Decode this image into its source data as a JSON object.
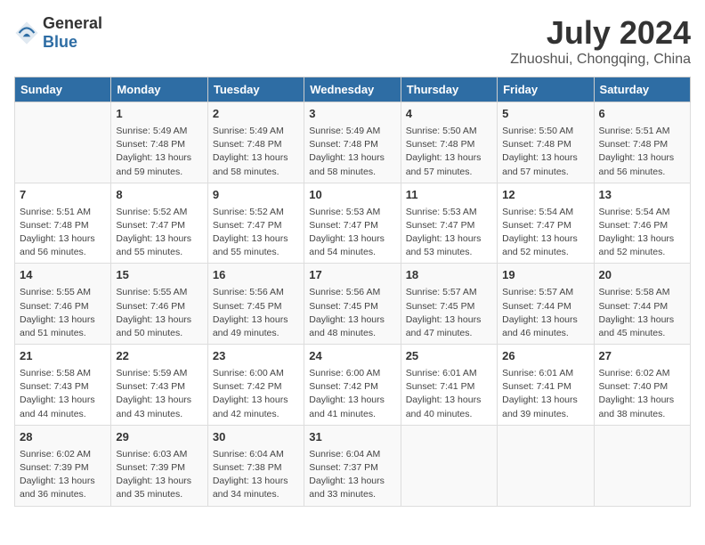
{
  "header": {
    "logo_general": "General",
    "logo_blue": "Blue",
    "title": "July 2024",
    "subtitle": "Zhuoshui, Chongqing, China"
  },
  "columns": [
    "Sunday",
    "Monday",
    "Tuesday",
    "Wednesday",
    "Thursday",
    "Friday",
    "Saturday"
  ],
  "weeks": [
    [
      {
        "day": "",
        "content": ""
      },
      {
        "day": "1",
        "content": "Sunrise: 5:49 AM\nSunset: 7:48 PM\nDaylight: 13 hours\nand 59 minutes."
      },
      {
        "day": "2",
        "content": "Sunrise: 5:49 AM\nSunset: 7:48 PM\nDaylight: 13 hours\nand 58 minutes."
      },
      {
        "day": "3",
        "content": "Sunrise: 5:49 AM\nSunset: 7:48 PM\nDaylight: 13 hours\nand 58 minutes."
      },
      {
        "day": "4",
        "content": "Sunrise: 5:50 AM\nSunset: 7:48 PM\nDaylight: 13 hours\nand 57 minutes."
      },
      {
        "day": "5",
        "content": "Sunrise: 5:50 AM\nSunset: 7:48 PM\nDaylight: 13 hours\nand 57 minutes."
      },
      {
        "day": "6",
        "content": "Sunrise: 5:51 AM\nSunset: 7:48 PM\nDaylight: 13 hours\nand 56 minutes."
      }
    ],
    [
      {
        "day": "7",
        "content": "Sunrise: 5:51 AM\nSunset: 7:48 PM\nDaylight: 13 hours\nand 56 minutes."
      },
      {
        "day": "8",
        "content": "Sunrise: 5:52 AM\nSunset: 7:47 PM\nDaylight: 13 hours\nand 55 minutes."
      },
      {
        "day": "9",
        "content": "Sunrise: 5:52 AM\nSunset: 7:47 PM\nDaylight: 13 hours\nand 55 minutes."
      },
      {
        "day": "10",
        "content": "Sunrise: 5:53 AM\nSunset: 7:47 PM\nDaylight: 13 hours\nand 54 minutes."
      },
      {
        "day": "11",
        "content": "Sunrise: 5:53 AM\nSunset: 7:47 PM\nDaylight: 13 hours\nand 53 minutes."
      },
      {
        "day": "12",
        "content": "Sunrise: 5:54 AM\nSunset: 7:47 PM\nDaylight: 13 hours\nand 52 minutes."
      },
      {
        "day": "13",
        "content": "Sunrise: 5:54 AM\nSunset: 7:46 PM\nDaylight: 13 hours\nand 52 minutes."
      }
    ],
    [
      {
        "day": "14",
        "content": "Sunrise: 5:55 AM\nSunset: 7:46 PM\nDaylight: 13 hours\nand 51 minutes."
      },
      {
        "day": "15",
        "content": "Sunrise: 5:55 AM\nSunset: 7:46 PM\nDaylight: 13 hours\nand 50 minutes."
      },
      {
        "day": "16",
        "content": "Sunrise: 5:56 AM\nSunset: 7:45 PM\nDaylight: 13 hours\nand 49 minutes."
      },
      {
        "day": "17",
        "content": "Sunrise: 5:56 AM\nSunset: 7:45 PM\nDaylight: 13 hours\nand 48 minutes."
      },
      {
        "day": "18",
        "content": "Sunrise: 5:57 AM\nSunset: 7:45 PM\nDaylight: 13 hours\nand 47 minutes."
      },
      {
        "day": "19",
        "content": "Sunrise: 5:57 AM\nSunset: 7:44 PM\nDaylight: 13 hours\nand 46 minutes."
      },
      {
        "day": "20",
        "content": "Sunrise: 5:58 AM\nSunset: 7:44 PM\nDaylight: 13 hours\nand 45 minutes."
      }
    ],
    [
      {
        "day": "21",
        "content": "Sunrise: 5:58 AM\nSunset: 7:43 PM\nDaylight: 13 hours\nand 44 minutes."
      },
      {
        "day": "22",
        "content": "Sunrise: 5:59 AM\nSunset: 7:43 PM\nDaylight: 13 hours\nand 43 minutes."
      },
      {
        "day": "23",
        "content": "Sunrise: 6:00 AM\nSunset: 7:42 PM\nDaylight: 13 hours\nand 42 minutes."
      },
      {
        "day": "24",
        "content": "Sunrise: 6:00 AM\nSunset: 7:42 PM\nDaylight: 13 hours\nand 41 minutes."
      },
      {
        "day": "25",
        "content": "Sunrise: 6:01 AM\nSunset: 7:41 PM\nDaylight: 13 hours\nand 40 minutes."
      },
      {
        "day": "26",
        "content": "Sunrise: 6:01 AM\nSunset: 7:41 PM\nDaylight: 13 hours\nand 39 minutes."
      },
      {
        "day": "27",
        "content": "Sunrise: 6:02 AM\nSunset: 7:40 PM\nDaylight: 13 hours\nand 38 minutes."
      }
    ],
    [
      {
        "day": "28",
        "content": "Sunrise: 6:02 AM\nSunset: 7:39 PM\nDaylight: 13 hours\nand 36 minutes."
      },
      {
        "day": "29",
        "content": "Sunrise: 6:03 AM\nSunset: 7:39 PM\nDaylight: 13 hours\nand 35 minutes."
      },
      {
        "day": "30",
        "content": "Sunrise: 6:04 AM\nSunset: 7:38 PM\nDaylight: 13 hours\nand 34 minutes."
      },
      {
        "day": "31",
        "content": "Sunrise: 6:04 AM\nSunset: 7:37 PM\nDaylight: 13 hours\nand 33 minutes."
      },
      {
        "day": "",
        "content": ""
      },
      {
        "day": "",
        "content": ""
      },
      {
        "day": "",
        "content": ""
      }
    ]
  ]
}
